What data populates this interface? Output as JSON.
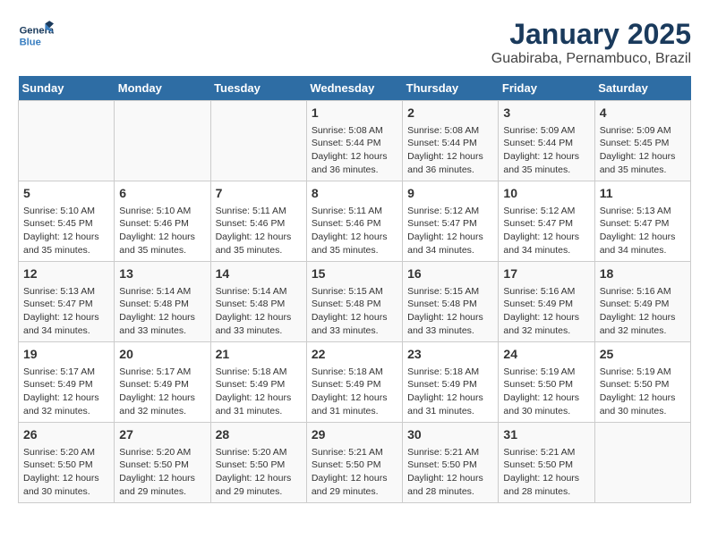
{
  "header": {
    "logo_line1": "General",
    "logo_line2": "Blue",
    "month": "January 2025",
    "location": "Guabiraba, Pernambuco, Brazil"
  },
  "days_of_week": [
    "Sunday",
    "Monday",
    "Tuesday",
    "Wednesday",
    "Thursday",
    "Friday",
    "Saturday"
  ],
  "weeks": [
    [
      {
        "day": "",
        "content": ""
      },
      {
        "day": "",
        "content": ""
      },
      {
        "day": "",
        "content": ""
      },
      {
        "day": "1",
        "content": "Sunrise: 5:08 AM\nSunset: 5:44 PM\nDaylight: 12 hours\nand 36 minutes."
      },
      {
        "day": "2",
        "content": "Sunrise: 5:08 AM\nSunset: 5:44 PM\nDaylight: 12 hours\nand 36 minutes."
      },
      {
        "day": "3",
        "content": "Sunrise: 5:09 AM\nSunset: 5:44 PM\nDaylight: 12 hours\nand 35 minutes."
      },
      {
        "day": "4",
        "content": "Sunrise: 5:09 AM\nSunset: 5:45 PM\nDaylight: 12 hours\nand 35 minutes."
      }
    ],
    [
      {
        "day": "5",
        "content": "Sunrise: 5:10 AM\nSunset: 5:45 PM\nDaylight: 12 hours\nand 35 minutes."
      },
      {
        "day": "6",
        "content": "Sunrise: 5:10 AM\nSunset: 5:46 PM\nDaylight: 12 hours\nand 35 minutes."
      },
      {
        "day": "7",
        "content": "Sunrise: 5:11 AM\nSunset: 5:46 PM\nDaylight: 12 hours\nand 35 minutes."
      },
      {
        "day": "8",
        "content": "Sunrise: 5:11 AM\nSunset: 5:46 PM\nDaylight: 12 hours\nand 35 minutes."
      },
      {
        "day": "9",
        "content": "Sunrise: 5:12 AM\nSunset: 5:47 PM\nDaylight: 12 hours\nand 34 minutes."
      },
      {
        "day": "10",
        "content": "Sunrise: 5:12 AM\nSunset: 5:47 PM\nDaylight: 12 hours\nand 34 minutes."
      },
      {
        "day": "11",
        "content": "Sunrise: 5:13 AM\nSunset: 5:47 PM\nDaylight: 12 hours\nand 34 minutes."
      }
    ],
    [
      {
        "day": "12",
        "content": "Sunrise: 5:13 AM\nSunset: 5:47 PM\nDaylight: 12 hours\nand 34 minutes."
      },
      {
        "day": "13",
        "content": "Sunrise: 5:14 AM\nSunset: 5:48 PM\nDaylight: 12 hours\nand 33 minutes."
      },
      {
        "day": "14",
        "content": "Sunrise: 5:14 AM\nSunset: 5:48 PM\nDaylight: 12 hours\nand 33 minutes."
      },
      {
        "day": "15",
        "content": "Sunrise: 5:15 AM\nSunset: 5:48 PM\nDaylight: 12 hours\nand 33 minutes."
      },
      {
        "day": "16",
        "content": "Sunrise: 5:15 AM\nSunset: 5:48 PM\nDaylight: 12 hours\nand 33 minutes."
      },
      {
        "day": "17",
        "content": "Sunrise: 5:16 AM\nSunset: 5:49 PM\nDaylight: 12 hours\nand 32 minutes."
      },
      {
        "day": "18",
        "content": "Sunrise: 5:16 AM\nSunset: 5:49 PM\nDaylight: 12 hours\nand 32 minutes."
      }
    ],
    [
      {
        "day": "19",
        "content": "Sunrise: 5:17 AM\nSunset: 5:49 PM\nDaylight: 12 hours\nand 32 minutes."
      },
      {
        "day": "20",
        "content": "Sunrise: 5:17 AM\nSunset: 5:49 PM\nDaylight: 12 hours\nand 32 minutes."
      },
      {
        "day": "21",
        "content": "Sunrise: 5:18 AM\nSunset: 5:49 PM\nDaylight: 12 hours\nand 31 minutes."
      },
      {
        "day": "22",
        "content": "Sunrise: 5:18 AM\nSunset: 5:49 PM\nDaylight: 12 hours\nand 31 minutes."
      },
      {
        "day": "23",
        "content": "Sunrise: 5:18 AM\nSunset: 5:49 PM\nDaylight: 12 hours\nand 31 minutes."
      },
      {
        "day": "24",
        "content": "Sunrise: 5:19 AM\nSunset: 5:50 PM\nDaylight: 12 hours\nand 30 minutes."
      },
      {
        "day": "25",
        "content": "Sunrise: 5:19 AM\nSunset: 5:50 PM\nDaylight: 12 hours\nand 30 minutes."
      }
    ],
    [
      {
        "day": "26",
        "content": "Sunrise: 5:20 AM\nSunset: 5:50 PM\nDaylight: 12 hours\nand 30 minutes."
      },
      {
        "day": "27",
        "content": "Sunrise: 5:20 AM\nSunset: 5:50 PM\nDaylight: 12 hours\nand 29 minutes."
      },
      {
        "day": "28",
        "content": "Sunrise: 5:20 AM\nSunset: 5:50 PM\nDaylight: 12 hours\nand 29 minutes."
      },
      {
        "day": "29",
        "content": "Sunrise: 5:21 AM\nSunset: 5:50 PM\nDaylight: 12 hours\nand 29 minutes."
      },
      {
        "day": "30",
        "content": "Sunrise: 5:21 AM\nSunset: 5:50 PM\nDaylight: 12 hours\nand 28 minutes."
      },
      {
        "day": "31",
        "content": "Sunrise: 5:21 AM\nSunset: 5:50 PM\nDaylight: 12 hours\nand 28 minutes."
      },
      {
        "day": "",
        "content": ""
      }
    ]
  ]
}
